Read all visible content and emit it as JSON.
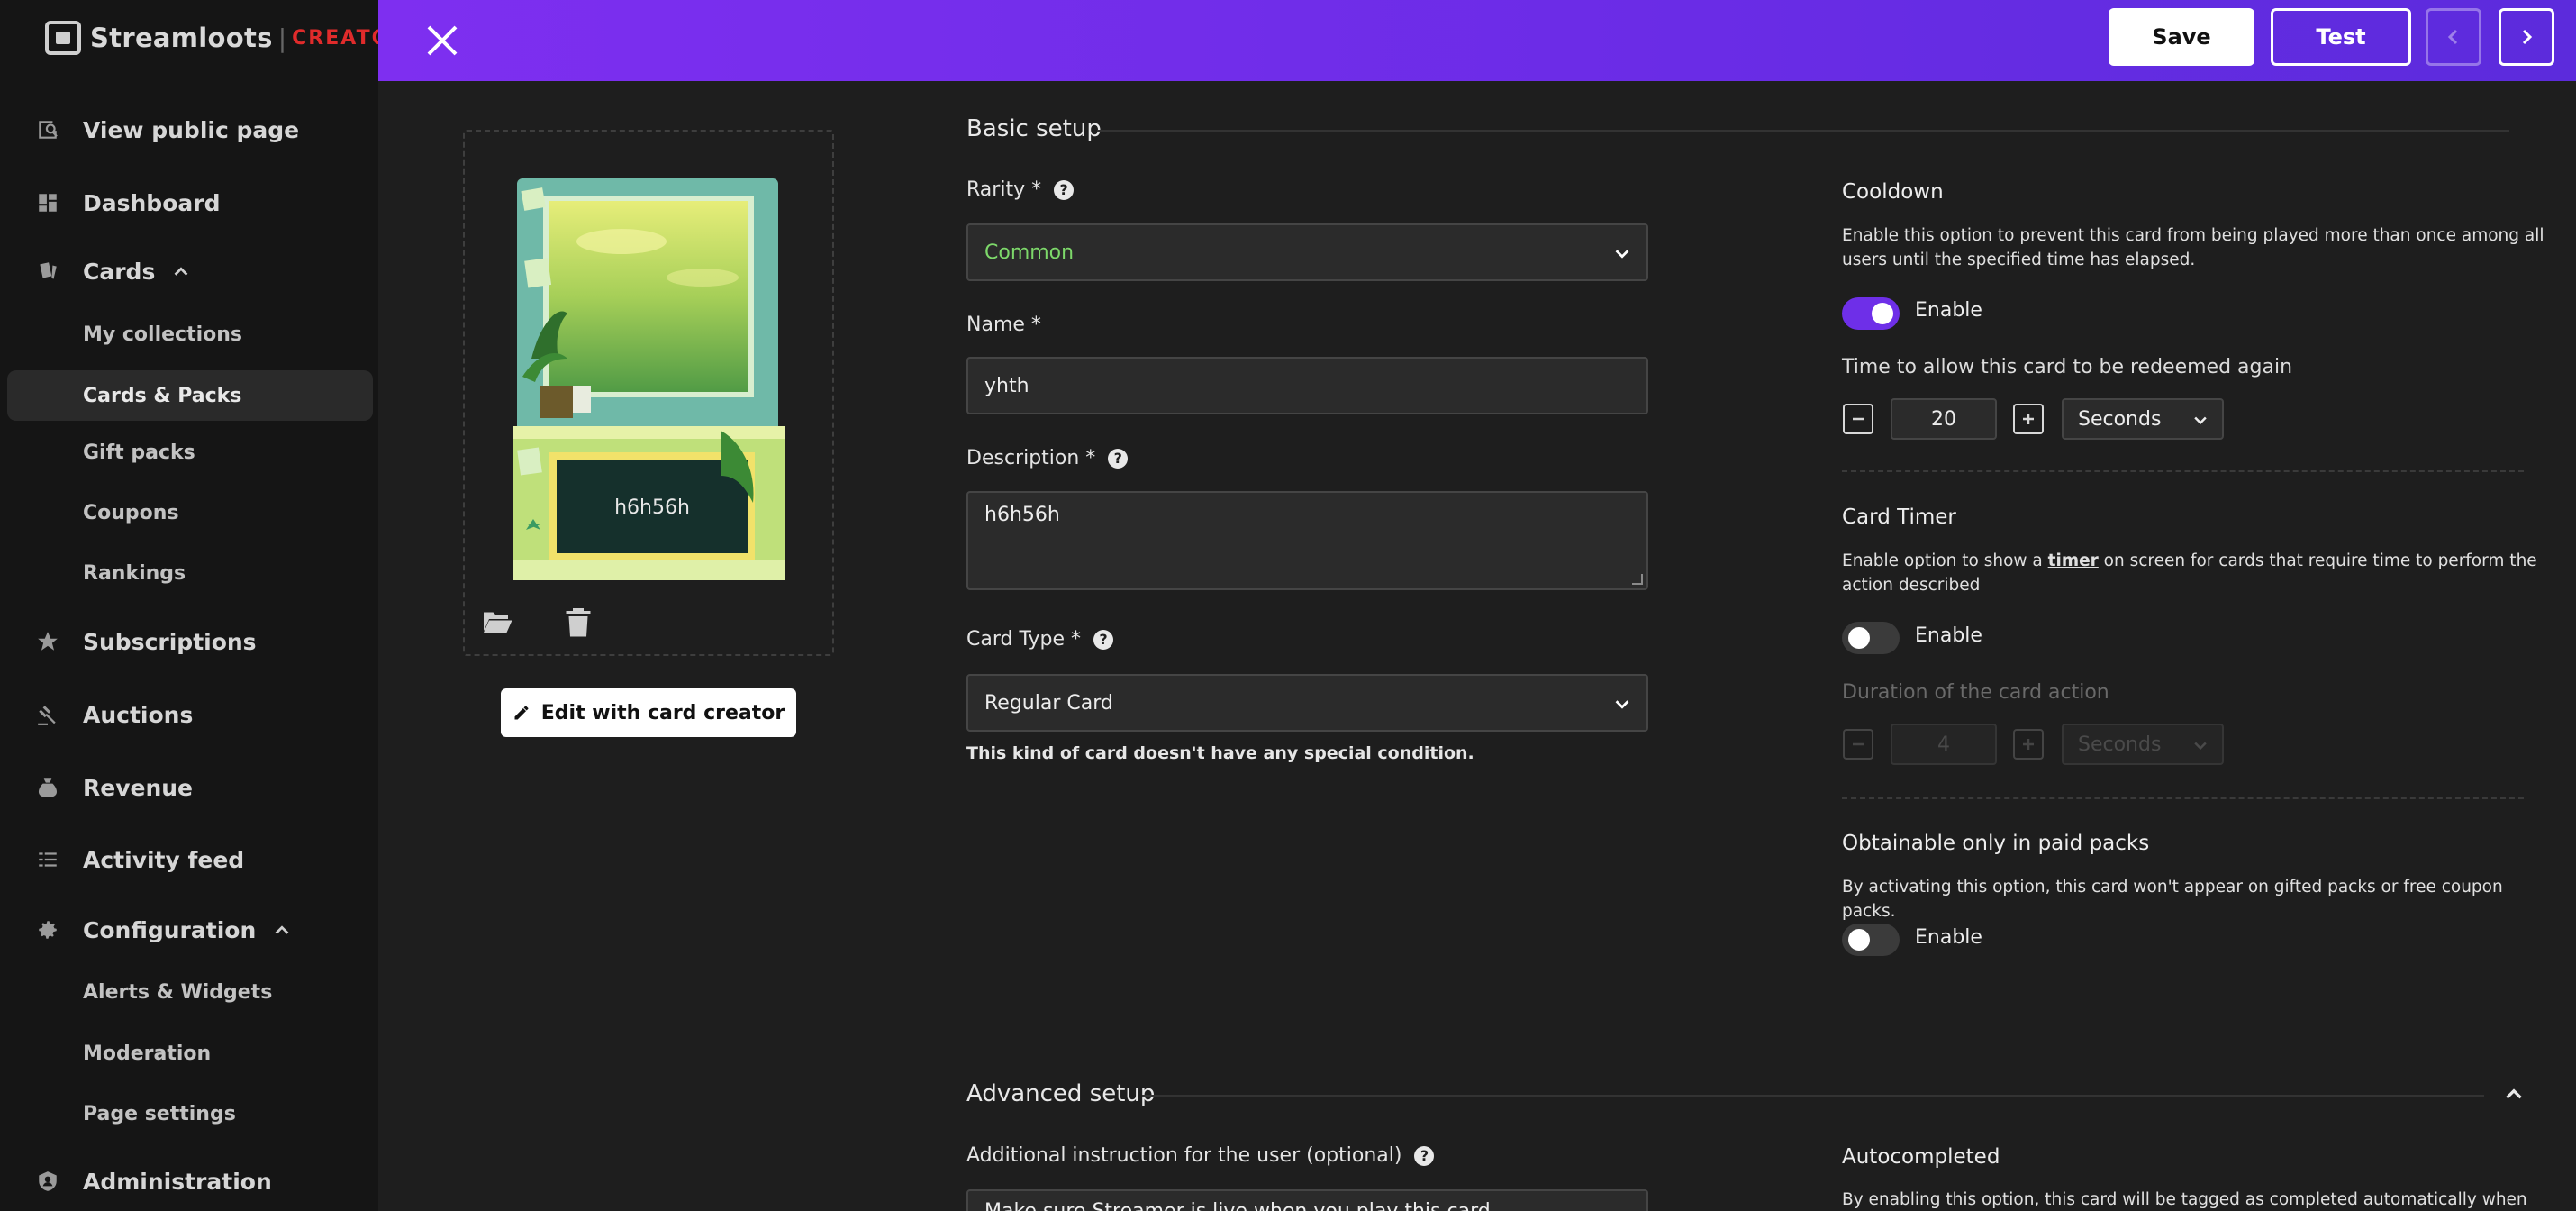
{
  "sidebar": {
    "logo_text": "Streamloots",
    "logo_separator": "|",
    "logo_tag": "CREATOR",
    "items": [
      {
        "label": "View public page",
        "icon": "public-page-icon"
      },
      {
        "label": "Dashboard",
        "icon": "dashboard-icon"
      },
      {
        "label": "Cards",
        "icon": "cards-icon",
        "expanded": true
      },
      {
        "label": "Subscriptions",
        "icon": "star-icon"
      },
      {
        "label": "Auctions",
        "icon": "gavel-icon"
      },
      {
        "label": "Revenue",
        "icon": "money-bag-icon"
      },
      {
        "label": "Activity feed",
        "icon": "activity-icon"
      },
      {
        "label": "Configuration",
        "icon": "gear-icon",
        "expanded": true
      },
      {
        "label": "Administration",
        "icon": "admin-icon"
      }
    ],
    "cards_sub": [
      "My collections",
      "Cards & Packs",
      "Gift packs",
      "Coupons",
      "Rankings"
    ],
    "config_sub": [
      "Alerts & Widgets",
      "Moderation",
      "Page settings"
    ],
    "active_sub": "Cards & Packs"
  },
  "topbar": {
    "save_label": "Save",
    "test_label": "Test"
  },
  "preview": {
    "card_text": "h6h56h",
    "edit_label": "Edit with card creator"
  },
  "basic": {
    "title": "Basic setup",
    "rarity_label": "Rarity *",
    "rarity_value": "Common",
    "name_label": "Name *",
    "name_value": "yhth",
    "desc_label": "Description *",
    "desc_value": "h6h56h",
    "type_label": "Card Type *",
    "type_value": "Regular Card",
    "type_hint": "This kind of card doesn't have any special condition."
  },
  "cooldown": {
    "title": "Cooldown",
    "desc": "Enable this option to prevent this card from being played more than once among all users until the specified time has elapsed.",
    "enable_label": "Enable",
    "enabled": true,
    "sub_label": "Time to allow this card to be redeemed again",
    "value": "20",
    "unit": "Seconds"
  },
  "timer": {
    "title": "Card Timer",
    "desc_pre": "Enable option to show a ",
    "desc_link": "timer",
    "desc_post": " on screen for cards that require time to perform the action described",
    "enable_label": "Enable",
    "enabled": false,
    "sub_label": "Duration of the card action",
    "value": "4",
    "unit": "Seconds"
  },
  "paid": {
    "title": "Obtainable only in paid packs",
    "desc": "By activating this option, this card won't appear on gifted packs or free coupon packs.",
    "enable_label": "Enable",
    "enabled": false
  },
  "advanced": {
    "title": "Advanced setup",
    "instruction_label": "Additional instruction for the user (optional)",
    "instruction_value": "Make sure Streamer is live when you play this card",
    "auto_title": "Autocompleted",
    "auto_desc": "By enabling this option, this card will be tagged as completed automatically when played."
  },
  "colors": {
    "accent": "#6e2fe8",
    "rarity_common": "#7dd86a",
    "logo_tag": "#e02b2b"
  }
}
